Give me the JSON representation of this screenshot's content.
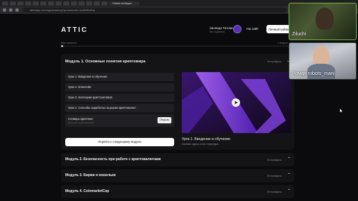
{
  "browser": {
    "active_tab_label": "Новая вкладка",
    "url": "atticalgo.com/app/learning?promocode=1cdN3hn5hp"
  },
  "header": {
    "logo": "ATTIC",
    "user_name": "Зинаида Титова",
    "user_subtitle": "Без подписки",
    "site_button": "На сайт",
    "cabinet_button": "Личный кабинет"
  },
  "progress": {
    "label": "Ваш прогресс",
    "right_label": "1 модуль",
    "value": 0.0
  },
  "open_module": {
    "title": "Модуль 1. Основные понятия криптомира",
    "status": "Не пройдено",
    "lessons": [
      "Урок 1. Введение в обучение",
      "Урок 2. Блокчейн",
      "Урок 3. Категории криптоактивов",
      "Урок 4. Способы заработка на рынке криптовалют"
    ],
    "dictionary": {
      "title": "Словарь криптана",
      "subtitle": "Дополнительный материал",
      "open_button": "Открыть"
    },
    "next_button": "Перейти к следующему модулю",
    "video_title": "Урок 1. Введение в обучение",
    "video_subtitle": "Основы курса и его структура."
  },
  "modules": [
    {
      "title": "Модуль 2. Безопасность при работе с криптовалютами",
      "status": "Не пройдено"
    },
    {
      "title": "Модуль 3. Биржи и кошельки",
      "status": "Не пройдено"
    },
    {
      "title": "Модуль 4. CoinmarketCap",
      "status": "Не пройдено"
    }
  ],
  "call": {
    "participant_1": "Ziluchi",
    "participant_2": "Роман robots_mani"
  },
  "icons": {
    "chevron": "chevron-up-icon",
    "play": "play-icon",
    "avatar": "avatar-icon"
  },
  "colors": {
    "background": "#0b0b0d",
    "card": "#141417",
    "accent_purple": "#7a3ff0",
    "active_speaker": "#7ab34a"
  }
}
